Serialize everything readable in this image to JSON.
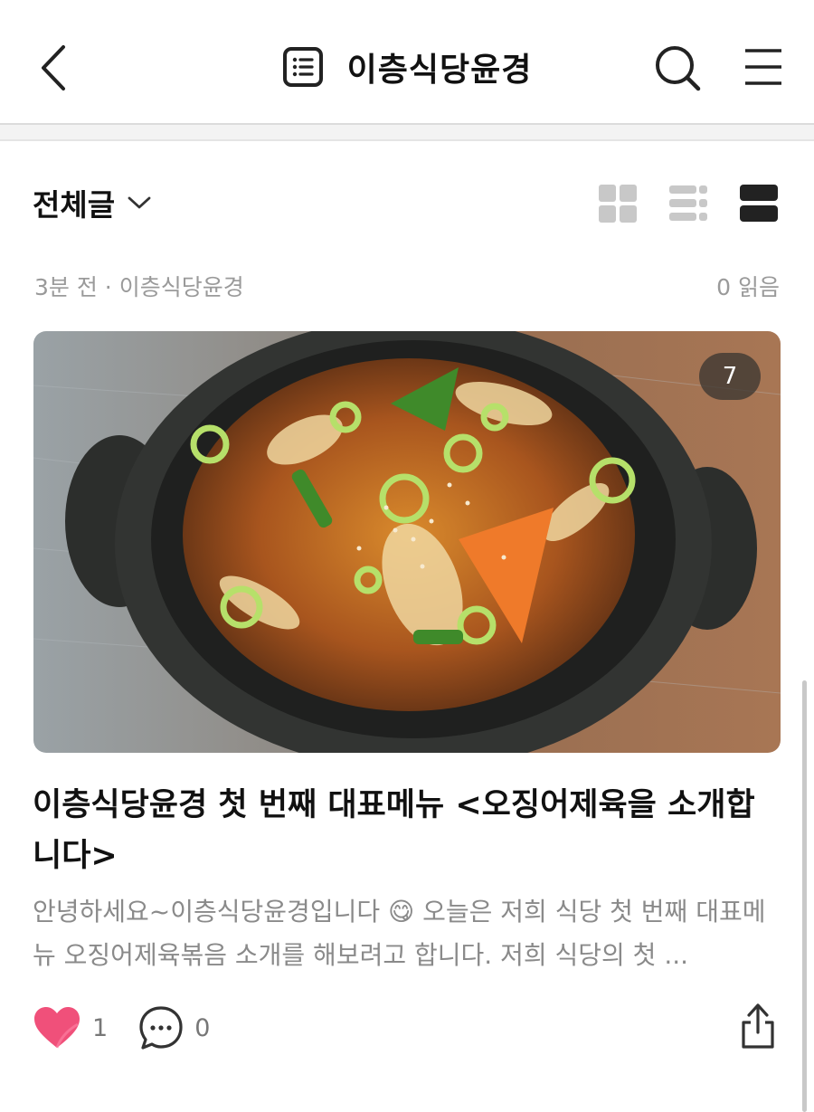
{
  "header": {
    "title": "이층식당윤경",
    "back_icon": "chevron-left-icon",
    "blog_icon": "list-document-icon",
    "search_icon": "search-icon",
    "menu_icon": "hamburger-menu-icon"
  },
  "filter": {
    "label": "전체글",
    "dropdown_icon": "chevron-down-icon"
  },
  "view_modes": [
    "grid-view-icon",
    "list-view-icon",
    "card-view-icon"
  ],
  "post": {
    "time_author": "3분 전 · 이층식당윤경",
    "reads": "0 읽음",
    "image_count": "7",
    "image_description_icon": "food-photo",
    "title": "이층식당윤경 첫 번째 대표메뉴  <오징어제육을 소개합니다>",
    "excerpt": "안녕하세요~이층식당윤경입니다 😋  오늘은 저희 식당 첫 번째 대표메뉴 오징어제육볶음 소개를 해보려고 합니다. 저희 식당의 첫 ...",
    "likes": "1",
    "comments": "0"
  },
  "colors": {
    "heart": "#f0507a",
    "icon_gray": "#c8c8c8",
    "icon_dark": "#222222",
    "meta_text": "#9a9a9a"
  }
}
